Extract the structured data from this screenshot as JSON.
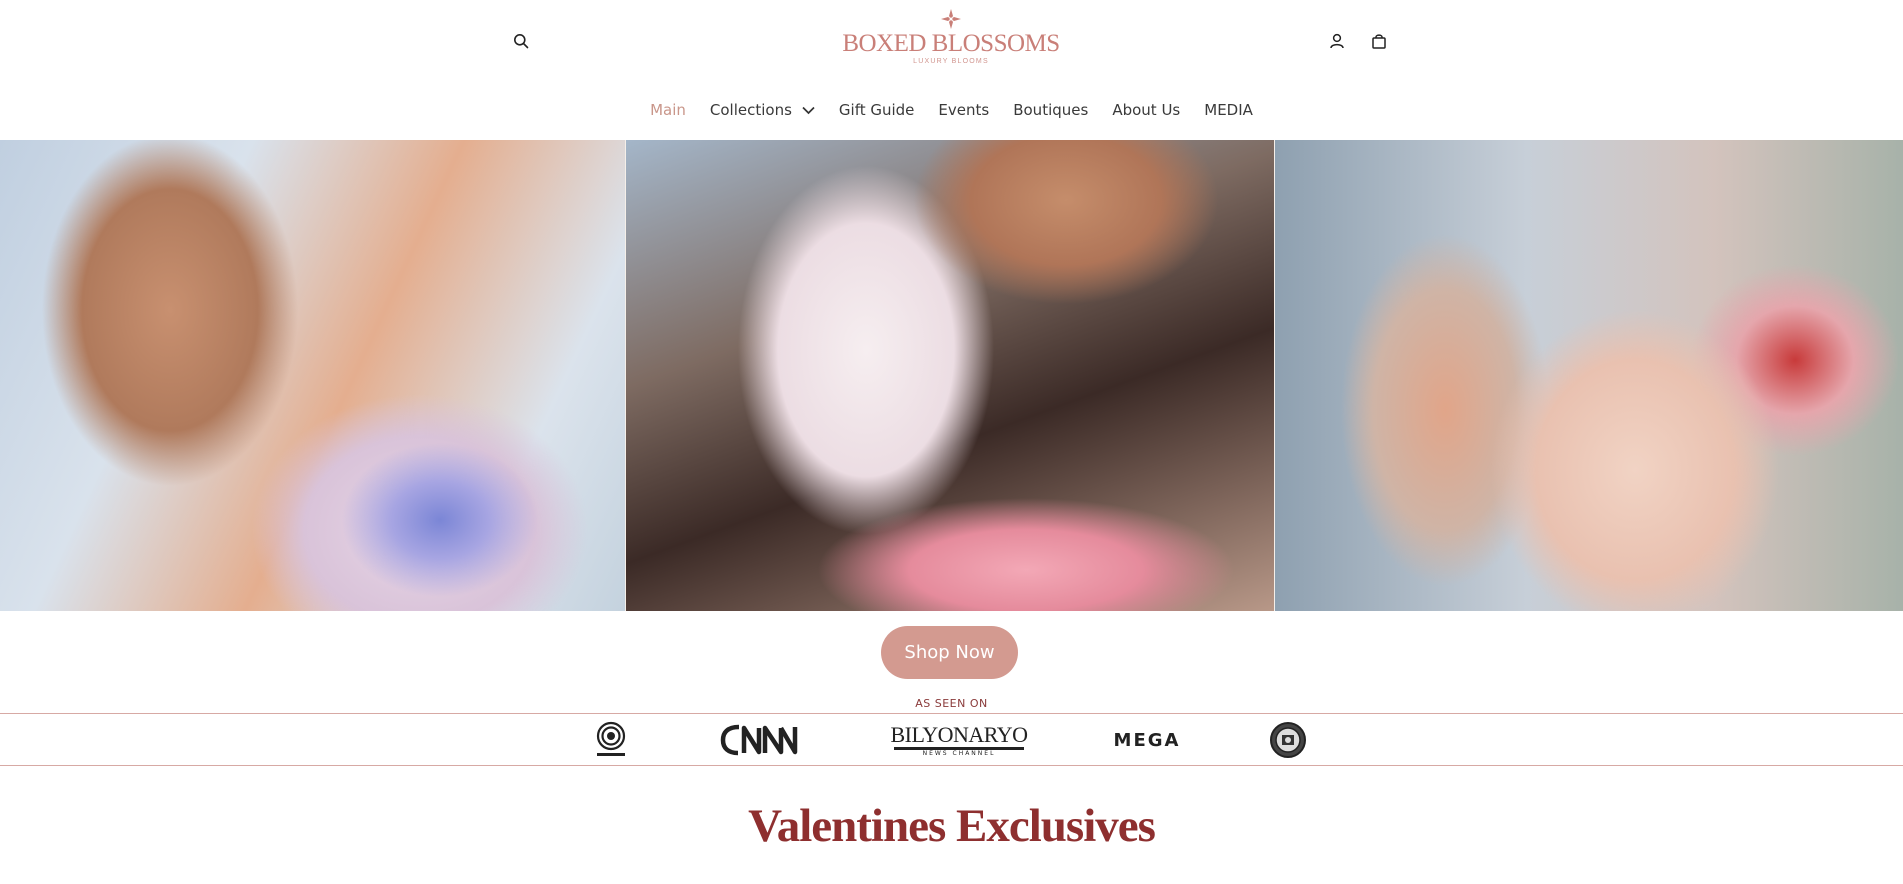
{
  "header": {
    "logo_text": "BOXED BLOSSOMS",
    "logo_tagline": "LUXURY BLOOMS",
    "icons": {
      "search": "search-icon",
      "account": "user-icon",
      "cart": "shopping-bag-icon"
    }
  },
  "nav": {
    "items": [
      {
        "label": "Main",
        "active": true
      },
      {
        "label": "Collections",
        "has_dropdown": true
      },
      {
        "label": "Gift Guide"
      },
      {
        "label": "Events"
      },
      {
        "label": "Boutiques"
      },
      {
        "label": "About Us"
      },
      {
        "label": "MEDIA"
      }
    ]
  },
  "hero": {
    "cta_label": "Shop Now"
  },
  "press": {
    "label": "AS SEEN ON",
    "logos": [
      {
        "name": "ABS-CBN",
        "text": "ABS-CBN"
      },
      {
        "name": "CNN",
        "text": "CNN"
      },
      {
        "name": "Bilyonaryo",
        "text": "BILYONARYO",
        "subtext": "NEWS CHANNEL"
      },
      {
        "name": "MEGA",
        "text": "MEGA"
      },
      {
        "name": "seal-logo"
      }
    ]
  },
  "section": {
    "title": "Valentines Exclusives"
  },
  "colors": {
    "brand": "#c97f78",
    "nav_active": "#c9968a",
    "cta_bg": "#d39a90",
    "section_title": "#8e2f2f",
    "divider": "#d7a9a4"
  }
}
